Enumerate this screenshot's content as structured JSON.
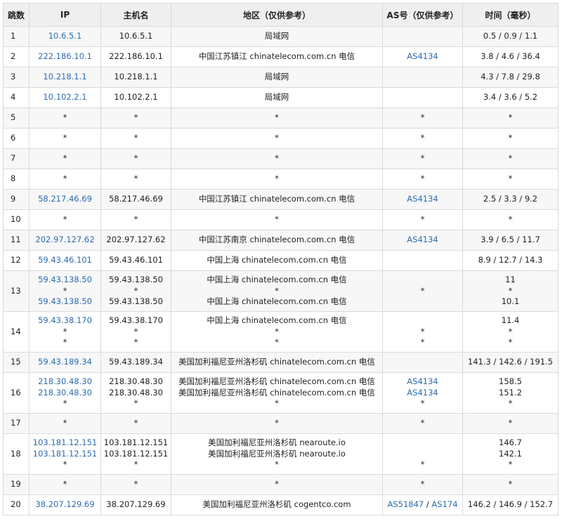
{
  "headers": [
    "跳数",
    "IP",
    "主机名",
    "地区（仅供参考）",
    "AS号（仅供参考）",
    "时间（毫秒）"
  ],
  "rows": [
    {
      "hop": "1",
      "ip": [
        "10.6.5.1"
      ],
      "host": [
        "10.6.5.1"
      ],
      "region": [
        "局域网"
      ],
      "asn": [
        []
      ],
      "time": [
        "0.5 / 0.9 / 1.1"
      ]
    },
    {
      "hop": "2",
      "ip": [
        "222.186.10.1"
      ],
      "host": [
        "222.186.10.1"
      ],
      "region": [
        "中国江苏镇江 chinatelecom.com.cn 电信"
      ],
      "asn": [
        [
          "AS4134"
        ]
      ],
      "time": [
        "3.8 / 4.6 / 36.4"
      ]
    },
    {
      "hop": "3",
      "ip": [
        "10.218.1.1"
      ],
      "host": [
        "10.218.1.1"
      ],
      "region": [
        "局域网"
      ],
      "asn": [
        []
      ],
      "time": [
        "4.3 / 7.8 / 29.8"
      ]
    },
    {
      "hop": "4",
      "ip": [
        "10.102.2.1"
      ],
      "host": [
        "10.102.2.1"
      ],
      "region": [
        "局域网"
      ],
      "asn": [
        []
      ],
      "time": [
        "3.4 / 3.6 / 5.2"
      ]
    },
    {
      "hop": "5",
      "ip": [
        "*"
      ],
      "host": [
        "*"
      ],
      "region": [
        "*"
      ],
      "asn": [
        [
          "*"
        ]
      ],
      "time": [
        "*"
      ]
    },
    {
      "hop": "6",
      "ip": [
        "*"
      ],
      "host": [
        "*"
      ],
      "region": [
        "*"
      ],
      "asn": [
        [
          "*"
        ]
      ],
      "time": [
        "*"
      ]
    },
    {
      "hop": "7",
      "ip": [
        "*"
      ],
      "host": [
        "*"
      ],
      "region": [
        "*"
      ],
      "asn": [
        [
          "*"
        ]
      ],
      "time": [
        "*"
      ]
    },
    {
      "hop": "8",
      "ip": [
        "*"
      ],
      "host": [
        "*"
      ],
      "region": [
        "*"
      ],
      "asn": [
        [
          "*"
        ]
      ],
      "time": [
        "*"
      ]
    },
    {
      "hop": "9",
      "ip": [
        "58.217.46.69"
      ],
      "host": [
        "58.217.46.69"
      ],
      "region": [
        "中国江苏镇江 chinatelecom.com.cn 电信"
      ],
      "asn": [
        [
          "AS4134"
        ]
      ],
      "time": [
        "2.5 / 3.3 / 9.2"
      ]
    },
    {
      "hop": "10",
      "ip": [
        "*"
      ],
      "host": [
        "*"
      ],
      "region": [
        "*"
      ],
      "asn": [
        [
          "*"
        ]
      ],
      "time": [
        "*"
      ]
    },
    {
      "hop": "11",
      "ip": [
        "202.97.127.62"
      ],
      "host": [
        "202.97.127.62"
      ],
      "region": [
        "中国江苏南京 chinatelecom.com.cn 电信"
      ],
      "asn": [
        [
          "AS4134"
        ]
      ],
      "time": [
        "3.9 / 6.5 / 11.7"
      ]
    },
    {
      "hop": "12",
      "ip": [
        "59.43.46.101"
      ],
      "host": [
        "59.43.46.101"
      ],
      "region": [
        "中国上海 chinatelecom.com.cn 电信"
      ],
      "asn": [
        []
      ],
      "time": [
        "8.9 / 12.7 / 14.3"
      ]
    },
    {
      "hop": "13",
      "ip": [
        "59.43.138.50",
        "*",
        "59.43.138.50"
      ],
      "host": [
        "59.43.138.50",
        "*",
        "59.43.138.50"
      ],
      "region": [
        "中国上海 chinatelecom.com.cn 电信",
        "*",
        "中国上海 chinatelecom.com.cn 电信"
      ],
      "asn": [
        [],
        [
          "*"
        ],
        []
      ],
      "time": [
        "11",
        "*",
        "10.1"
      ]
    },
    {
      "hop": "14",
      "ip": [
        "59.43.38.170",
        "*",
        "*"
      ],
      "host": [
        "59.43.38.170",
        "*",
        "*"
      ],
      "region": [
        "中国上海 chinatelecom.com.cn 电信",
        "*",
        "*"
      ],
      "asn": [
        [],
        [
          "*"
        ],
        [
          "*"
        ]
      ],
      "time": [
        "11.4",
        "*",
        "*"
      ]
    },
    {
      "hop": "15",
      "ip": [
        "59.43.189.34"
      ],
      "host": [
        "59.43.189.34"
      ],
      "region": [
        "美国加利福尼亚州洛杉矶 chinatelecom.com.cn 电信"
      ],
      "asn": [
        []
      ],
      "time": [
        "141.3 / 142.6 / 191.5"
      ]
    },
    {
      "hop": "16",
      "ip": [
        "218.30.48.30",
        "218.30.48.30",
        "*"
      ],
      "host": [
        "218.30.48.30",
        "218.30.48.30",
        "*"
      ],
      "region": [
        "美国加利福尼亚州洛杉矶 chinatelecom.com.cn 电信",
        "美国加利福尼亚州洛杉矶 chinatelecom.com.cn 电信",
        "*"
      ],
      "asn": [
        [
          "AS4134"
        ],
        [
          "AS4134"
        ],
        [
          "*"
        ]
      ],
      "time": [
        "158.5",
        "151.2",
        "*"
      ]
    },
    {
      "hop": "17",
      "ip": [
        "*"
      ],
      "host": [
        "*"
      ],
      "region": [
        "*"
      ],
      "asn": [
        [
          "*"
        ]
      ],
      "time": [
        "*"
      ]
    },
    {
      "hop": "18",
      "ip": [
        "103.181.12.151",
        "103.181.12.151",
        "*"
      ],
      "host": [
        "103.181.12.151",
        "103.181.12.151",
        "*"
      ],
      "region": [
        "美国加利福尼亚州洛杉矶 nearoute.io",
        "美国加利福尼亚州洛杉矶 nearoute.io",
        "*"
      ],
      "asn": [
        [],
        [],
        [
          "*"
        ]
      ],
      "time": [
        "146.7",
        "142.1",
        "*"
      ]
    },
    {
      "hop": "19",
      "ip": [
        "*"
      ],
      "host": [
        "*"
      ],
      "region": [
        "*"
      ],
      "asn": [
        [
          "*"
        ]
      ],
      "time": [
        "*"
      ]
    },
    {
      "hop": "20",
      "ip": [
        "38.207.129.69"
      ],
      "host": [
        "38.207.129.69"
      ],
      "region": [
        "美国加利福尼亚州洛杉矶 cogentco.com"
      ],
      "asn": [
        [
          "AS51847",
          "AS174"
        ]
      ],
      "time": [
        "146.2 / 146.9 / 152.7"
      ]
    }
  ]
}
